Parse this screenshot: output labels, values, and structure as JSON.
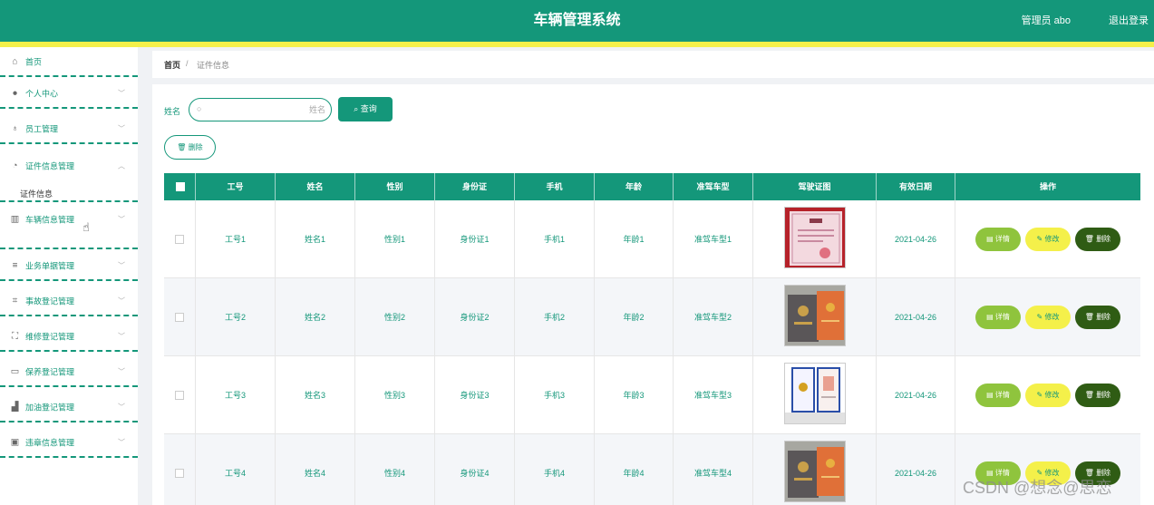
{
  "header": {
    "title": "车辆管理系统",
    "user_label": "管理员 abo",
    "logout_label": "退出登录",
    "colors": {
      "primary": "#14977a",
      "stripe": "#f4f04a"
    }
  },
  "sidebar": {
    "items": [
      {
        "label": "首页",
        "icon": "home-icon",
        "has_arrow": false
      },
      {
        "label": "个人中心",
        "icon": "user-icon",
        "has_arrow": true
      },
      {
        "label": "员工管理",
        "icon": "bell-icon",
        "has_arrow": true
      },
      {
        "label": "证件信息管理",
        "icon": "gauge-icon",
        "has_arrow": true
      },
      {
        "label": "车辆信息管理",
        "icon": "chart-icon",
        "has_arrow": true
      },
      {
        "label": "业务单据管理",
        "icon": "list-icon",
        "has_arrow": true
      },
      {
        "label": "事故登记管理",
        "icon": "crop-icon",
        "has_arrow": true
      },
      {
        "label": "维修登记管理",
        "icon": "expand-icon",
        "has_arrow": true
      },
      {
        "label": "保养登记管理",
        "icon": "card-icon",
        "has_arrow": true
      },
      {
        "label": "加油登记管理",
        "icon": "thumb-icon",
        "has_arrow": true
      },
      {
        "label": "违章信息管理",
        "icon": "photo-icon",
        "has_arrow": true
      }
    ],
    "submenu_label": "证件信息"
  },
  "breadcrumb": {
    "home": "首页",
    "separator": "/",
    "current": "证件信息"
  },
  "search": {
    "label": "姓名",
    "placeholder": "姓名",
    "query_button": "查询",
    "delete_button": "删除"
  },
  "table": {
    "columns": [
      "工号",
      "姓名",
      "性别",
      "身份证",
      "手机",
      "年龄",
      "准驾车型",
      "驾驶证图",
      "有效日期",
      "操作"
    ],
    "rows": [
      {
        "id": "工号1",
        "name": "姓名1",
        "gender": "性别1",
        "idcard": "身份证1",
        "phone": "手机1",
        "age": "年龄1",
        "vehicle": "准驾车型1",
        "date": "2021-04-26",
        "photo": "certificate-red"
      },
      {
        "id": "工号2",
        "name": "姓名2",
        "gender": "性别2",
        "idcard": "身份证2",
        "phone": "手机2",
        "age": "年龄2",
        "vehicle": "准驾车型2",
        "date": "2021-04-26",
        "photo": "certificate-book-orange"
      },
      {
        "id": "工号3",
        "name": "姓名3",
        "gender": "性别3",
        "idcard": "身份证3",
        "phone": "手机3",
        "age": "年龄3",
        "vehicle": "准驾车型3",
        "date": "2021-04-26",
        "photo": "certificate-white"
      },
      {
        "id": "工号4",
        "name": "姓名4",
        "gender": "性别4",
        "idcard": "身份证4",
        "phone": "手机4",
        "age": "年龄4",
        "vehicle": "准驾车型4",
        "date": "2021-04-26",
        "photo": "certificate-book-orange"
      }
    ],
    "actions": {
      "detail": "详情",
      "edit": "修改",
      "delete": "删除"
    },
    "colors": {
      "detail": "#8fc43d",
      "edit": "#f4f04a",
      "delete": "#2f5c14"
    }
  },
  "watermark": "CSDN @想念@思恋"
}
